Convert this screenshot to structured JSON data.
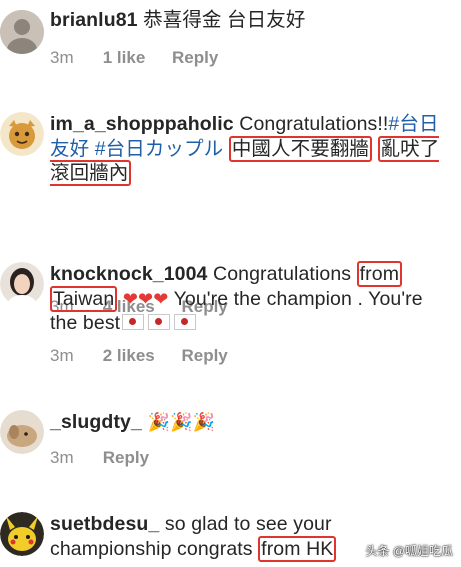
{
  "comments": [
    {
      "user": "brianlu81",
      "text": "恭喜得金 台日友好",
      "time": "3m",
      "likes": "1 like",
      "reply": "Reply"
    },
    {
      "user": "im_a_shopppaholic",
      "text_a": "Congratulations!!",
      "tag1": "#台日友好",
      "tag2": "#台日カップル",
      "hl1": "中國人不要翻牆",
      "hl2": "亂吠了 滾回牆內",
      "time": "3m",
      "likes": "4 likes",
      "reply": "Reply"
    },
    {
      "user": "knocknock_1004",
      "text_a": "Congratulations",
      "hl1": "from",
      "hl2": "Taiwan",
      "text_b": "You're the champion .",
      "text_c": "You're the best",
      "time": "3m",
      "likes": "2 likes",
      "reply": "Reply"
    },
    {
      "user": "_slugdty_",
      "emoji": "🎉🎉🎉",
      "time": "3m",
      "reply": "Reply"
    },
    {
      "user": "suetbdesu_",
      "text_a": "so glad to see your championship congrats",
      "hl1": "from HK"
    }
  ],
  "icons": {
    "heart": "❤",
    "flag": "japan-flag-icon",
    "party": "🎉"
  },
  "watermark": "头条 @呱姐吃瓜",
  "colors": {
    "highlight": "#e0342f",
    "hashtag": "#1f5ea8",
    "meta": "#8e8e8e"
  }
}
